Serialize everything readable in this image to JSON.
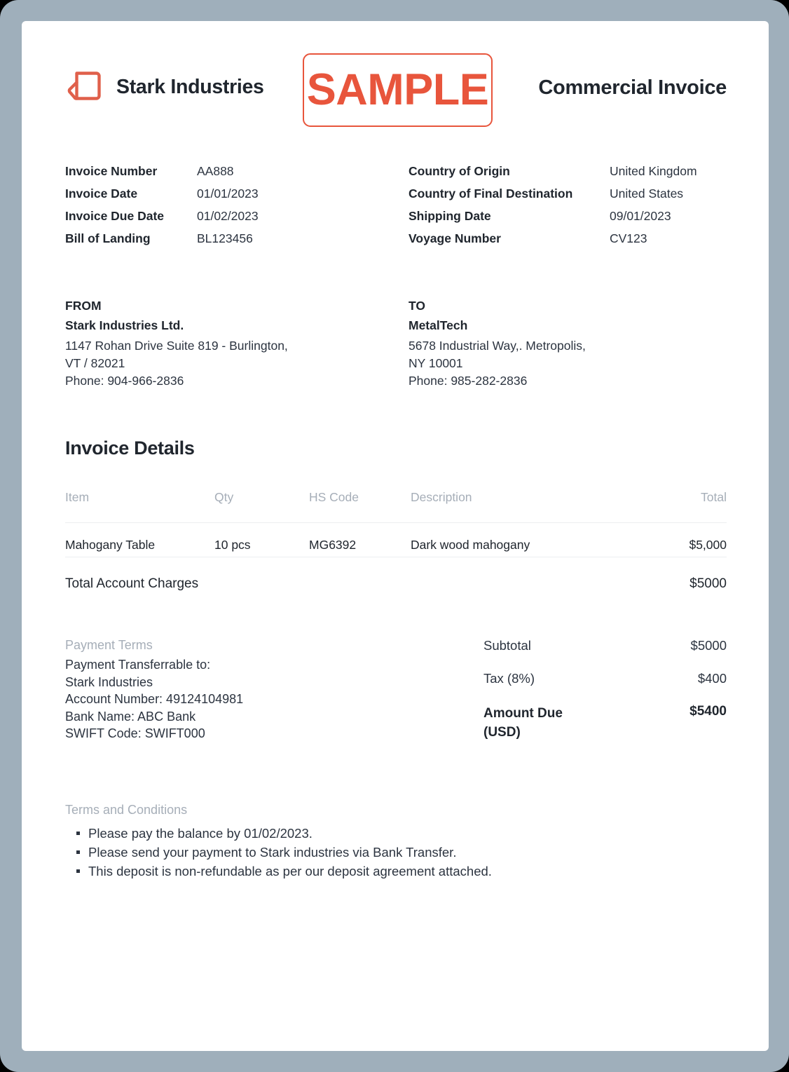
{
  "brand": {
    "name": "Stark Industries",
    "logo_icon": "page-fold-logo-icon"
  },
  "badge": {
    "text": "SAMPLE",
    "color": "#e8553c"
  },
  "document": {
    "title": "Commercial Invoice"
  },
  "meta": {
    "left": [
      {
        "label": "Invoice Number",
        "value": "AA888"
      },
      {
        "label": "Invoice Date",
        "value": "01/01/2023"
      },
      {
        "label": "Invoice Due Date",
        "value": "01/02/2023"
      },
      {
        "label": "Bill of Landing",
        "value": "BL123456"
      }
    ],
    "right": [
      {
        "label": "Country of Origin",
        "value": "United Kingdom"
      },
      {
        "label": "Country of Final Destination",
        "value": "United States"
      },
      {
        "label": "Shipping Date",
        "value": "09/01/2023"
      },
      {
        "label": "Voyage Number",
        "value": "CV123"
      }
    ]
  },
  "parties": {
    "from": {
      "kicker": "FROM",
      "name": "Stark Industries Ltd.",
      "address": "1147 Rohan Drive Suite 819 - Burlington,\nVT / 82021\nPhone: 904-966-2836"
    },
    "to": {
      "kicker": "TO",
      "name": "MetalTech",
      "address": "5678 Industrial Way,. Metropolis,\nNY 10001\nPhone: 985-282-2836"
    }
  },
  "details": {
    "heading": "Invoice Details",
    "columns": {
      "item": "Item",
      "qty": "Qty",
      "hs_code": "HS Code",
      "description": "Description",
      "total": "Total"
    },
    "rows": [
      {
        "item": "Mahogany Table",
        "qty": "10 pcs",
        "hs_code": "MG6392",
        "description": "Dark wood mahogany",
        "total": "$5,000"
      }
    ],
    "charges_label": "Total Account Charges",
    "charges_value": "$5000"
  },
  "payment": {
    "terms_label": "Payment Terms",
    "terms_body": "Payment Transferrable to:\nStark Industries\nAccount Number: 49124104981\nBank Name: ABC Bank\nSWIFT Code: SWIFT000"
  },
  "totals": {
    "subtotal_label": "Subtotal",
    "subtotal_value": "$5000",
    "tax_label": "Tax (8%)",
    "tax_value": "$400",
    "amount_due_label": "Amount Due (USD)",
    "amount_due_value": "$5400"
  },
  "terms": {
    "label": "Terms and Conditions",
    "items": [
      "Please pay the balance by 01/02/2023.",
      "Please send your payment to Stark industries via Bank Transfer.",
      "This deposit is non-refundable as per our deposit agreement attached."
    ]
  }
}
